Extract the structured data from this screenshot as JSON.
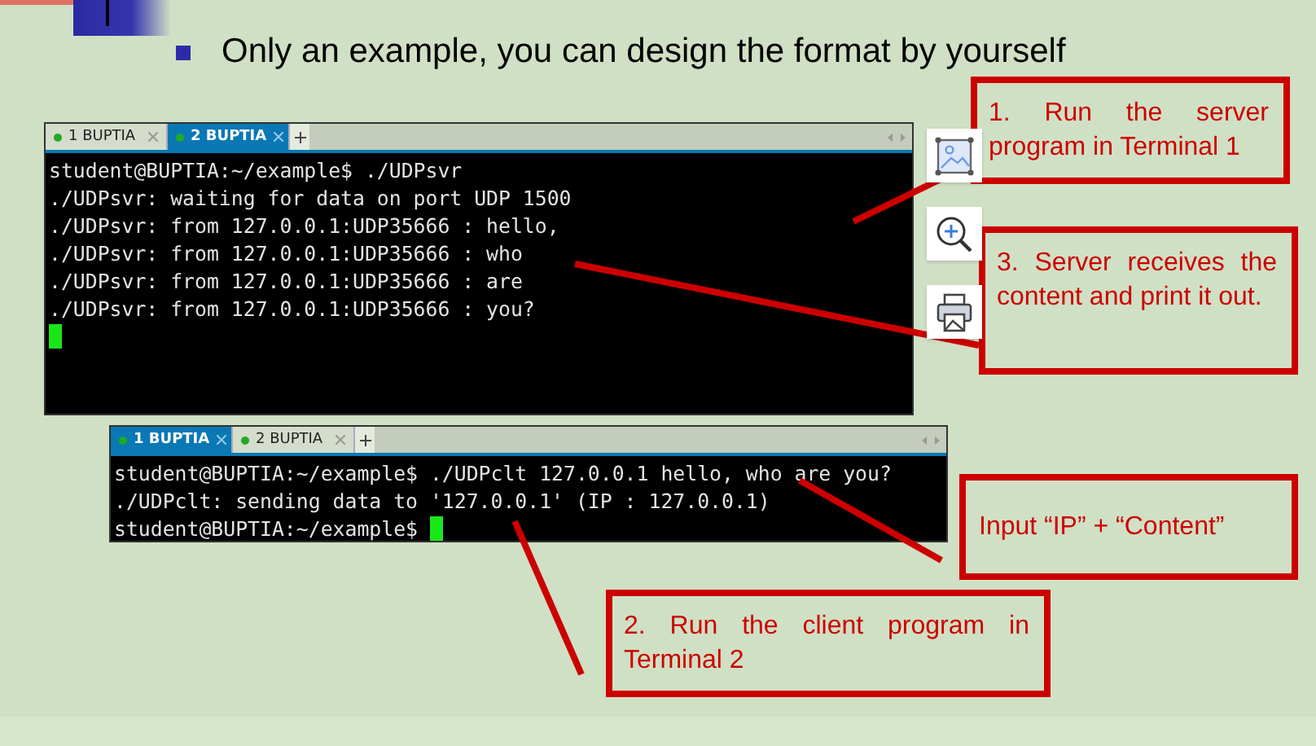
{
  "slide": {
    "bullet": "Only an example, you can design the format by yourself"
  },
  "terminals": [
    {
      "tabs": [
        {
          "label": "1 BUPTIA",
          "selected": false
        },
        {
          "label": "2 BUPTIA",
          "selected": true
        }
      ],
      "lines": [
        {
          "text": "student@BUPTIA:~/example$ ./UDPsvr",
          "cursor": false
        },
        {
          "text": "./UDPsvr: waiting for data on port UDP 1500",
          "cursor": false
        },
        {
          "text": "./UDPsvr: from 127.0.0.1:UDP35666 : hello,",
          "cursor": false
        },
        {
          "text": "./UDPsvr: from 127.0.0.1:UDP35666 : who",
          "cursor": false
        },
        {
          "text": "./UDPsvr: from 127.0.0.1:UDP35666 : are",
          "cursor": false
        },
        {
          "text": "./UDPsvr: from 127.0.0.1:UDP35666 : you?",
          "cursor": false
        },
        {
          "cursor": true
        }
      ]
    },
    {
      "tabs": [
        {
          "label": "1 BUPTIA",
          "selected": true
        },
        {
          "label": "2 BUPTIA",
          "selected": false
        }
      ],
      "lines": [
        {
          "text": "student@BUPTIA:~/example$ ./UDPclt 127.0.0.1 hello, who are you?",
          "cursor": false
        },
        {
          "text": "./UDPclt: sending data to '127.0.0.1' (IP : 127.0.0.1)",
          "cursor": false
        },
        {
          "text": "student@BUPTIA:~/example$ ",
          "cursor": true
        }
      ]
    }
  ],
  "callouts": [
    {
      "text": "1. Run the server program in Terminal 1"
    },
    {
      "text": "3. Server receives the content and print it out."
    },
    {
      "text": "Input “IP” + “Content”"
    },
    {
      "text": "2. Run the client program in Terminal 2"
    }
  ],
  "toolbar": [
    {
      "kind": "image"
    },
    {
      "kind": "zoom"
    },
    {
      "kind": "print"
    }
  ]
}
